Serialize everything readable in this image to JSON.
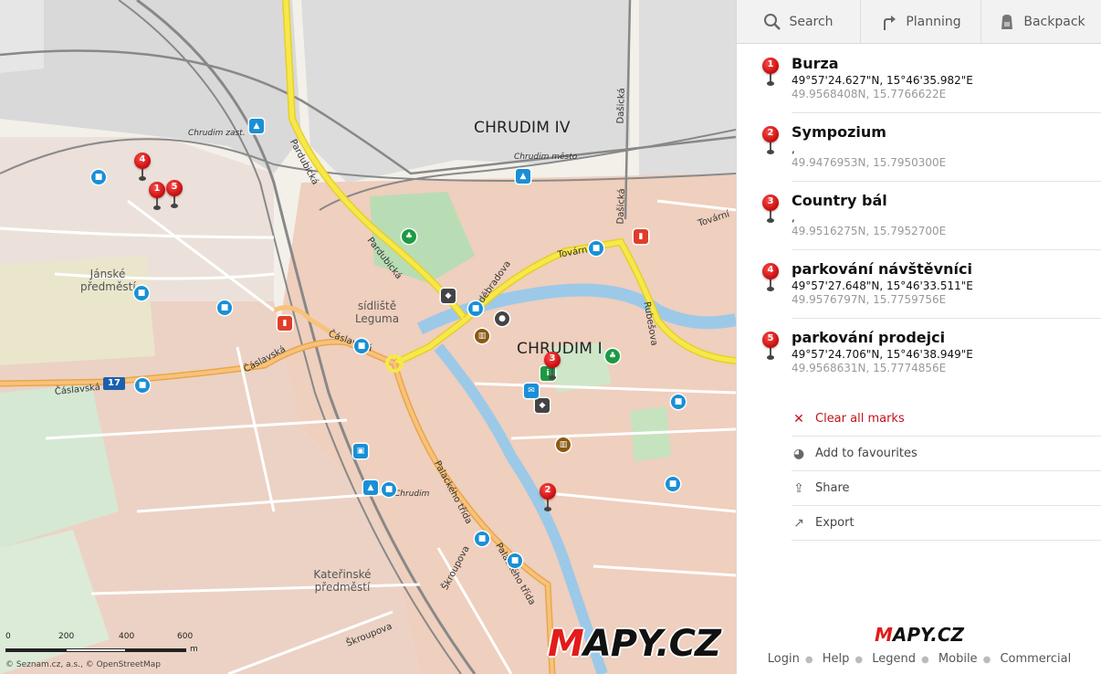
{
  "toolbar": {
    "search_label": "Search",
    "planning_label": "Planning",
    "backpack_label": "Backpack"
  },
  "marks": [
    {
      "num": "1",
      "title": "Burza",
      "coord": "49°57'24.627\"N, 15°46'35.982\"E",
      "decimal": "49.9568408N, 15.7766622E"
    },
    {
      "num": "2",
      "title": "Sympozium",
      "coord": ",",
      "decimal": "49.9476953N, 15.7950300E"
    },
    {
      "num": "3",
      "title": "Country bál",
      "coord": ",",
      "decimal": "49.9516275N, 15.7952700E"
    },
    {
      "num": "4",
      "title": "parkování návštěvníci",
      "coord": "49°57'27.648\"N, 15°46'33.511\"E",
      "decimal": "49.9576797N, 15.7759756E"
    },
    {
      "num": "5",
      "title": "parkování prodejci",
      "coord": "49°57'24.706\"N, 15°46'38.949\"E",
      "decimal": "49.9568631N, 15.7774856E"
    }
  ],
  "actions": {
    "clear": "Clear all marks",
    "favourites": "Add to favourites",
    "share": "Share",
    "export": "Export"
  },
  "footer": {
    "login": "Login",
    "help": "Help",
    "legend": "Legend",
    "mobile": "Mobile",
    "commercial": "Commercial"
  },
  "logo": {
    "m": "M",
    "rest": "APY.CZ"
  },
  "map": {
    "districts": {
      "chrudim4": "CHRUDIM IV",
      "chrudim1": "CHRUDIM I"
    },
    "areas": {
      "janske": "Jánské předměstí",
      "sidliste": "sídliště Leguma",
      "katerinske": "Kateřinské předměstí"
    },
    "stations": {
      "zast": "Chrudim zast.",
      "mesto": "Chrudim město",
      "chrudim": "Chrudim"
    },
    "streets": {
      "pardubicka1": "Pardubická",
      "pardubicka2": "Pardubická",
      "podebradova": "Poděbradova",
      "tovarni1": "Tovární",
      "tovarni2": "Tovární",
      "dasicka1": "Dašická",
      "dasicka2": "Dašická",
      "rubesova": "Rubešova",
      "caslavska1": "Čáslavská",
      "caslavska2": "Čáslavská",
      "caslavska3": "Čáslavská",
      "palackeho1": "Palackého třída",
      "palackeho2": "Palackého třída",
      "skroupova1": "Škroupova",
      "skroupova2": "Škroupova"
    },
    "road_shield": "17",
    "scale": {
      "t0": "0",
      "t200": "200",
      "t400": "400",
      "t600": "600",
      "unit": "m"
    },
    "copyright": "© Seznam.cz, a.s., © OpenStreetMap",
    "pins": [
      "1",
      "2",
      "3",
      "4",
      "5"
    ]
  },
  "colors": {
    "accent_red": "#e21b1b",
    "poi_blue": "#1a8fd6",
    "major_road": "#f7e23a"
  }
}
